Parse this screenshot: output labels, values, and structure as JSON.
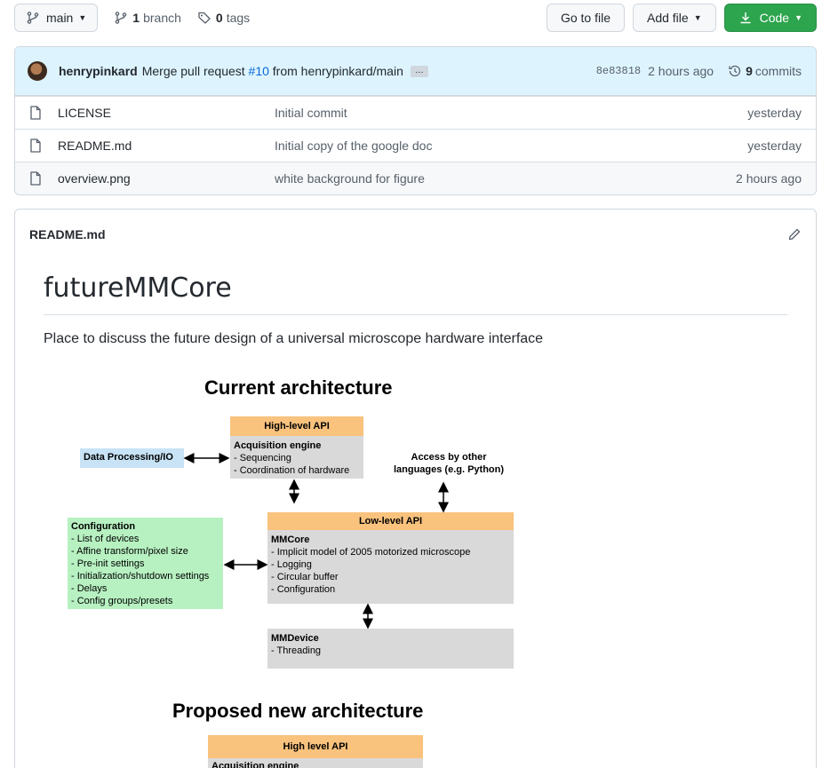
{
  "topbar": {
    "branch": "main",
    "branch_count": "1",
    "branch_label": "branch",
    "tag_count": "0",
    "tag_label": "tags",
    "go_to_file": "Go to file",
    "add_file": "Add file",
    "code": "Code"
  },
  "commit": {
    "author": "henrypinkard",
    "message_prefix": "Merge pull request",
    "pr": "#10",
    "message_suffix": "from henrypinkard/main",
    "ellipsis": "…",
    "sha": "8e83818",
    "ago": "2 hours ago",
    "commit_count": "9",
    "commits_label": "commits"
  },
  "files": [
    {
      "name": "LICENSE",
      "message": "Initial commit",
      "date": "yesterday"
    },
    {
      "name": "README.md",
      "message": "Initial copy of the google doc",
      "date": "yesterday"
    },
    {
      "name": "overview.png",
      "message": "white background for figure",
      "date": "2 hours ago"
    }
  ],
  "readme": {
    "filename": "README.md",
    "title": "futureMMCore",
    "description": "Place to discuss the future design of a universal microscope hardware interface"
  },
  "diagram": {
    "current_title": "Current architecture",
    "high_api": {
      "header": "High-level API",
      "name": "Acquisition engine",
      "lines": [
        "- Sequencing",
        "- Coordination of hardware"
      ]
    },
    "data_processing": "Data Processing/IO",
    "access_other": [
      "Access by other",
      "languages (e.g. Python)"
    ],
    "configuration": {
      "name": "Configuration",
      "lines": [
        "- List of devices",
        "- Affine transform/pixel size",
        "- Pre-init settings",
        "- Initialization/shutdown settings",
        "- Delays",
        "- Config groups/presets"
      ]
    },
    "low_api": {
      "header": "Low-level API",
      "name": "MMCore",
      "lines": [
        "- Implicit model of 2005 motorized microscope",
        "- Logging",
        "- Circular buffer",
        "- Configuration"
      ]
    },
    "mmdevice": {
      "name": "MMDevice",
      "lines": [
        "- Threading"
      ]
    },
    "proposed_title": "Proposed new architecture",
    "proposed_high_api": {
      "header": "High level API",
      "name": "Acquisition engine"
    }
  },
  "colors": {
    "accent": "#0969da",
    "code_button": "#2da44e",
    "commit_bar": "#ddf4ff",
    "api_header": "#f9c27d",
    "box_gray": "#d9d9d9",
    "config_green": "#b7f1c1",
    "data_blue": "#c7e3f5"
  }
}
